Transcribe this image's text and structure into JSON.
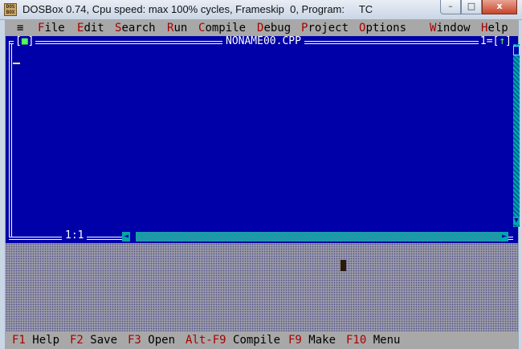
{
  "window": {
    "icon_text": "DOS BOX",
    "title": "DOSBox 0.74, Cpu speed: max 100% cycles, Frameskip  0, Program:     TC",
    "min_label": "–",
    "max_label": "□",
    "close_label": "x"
  },
  "menu": {
    "system_label": "≡",
    "items": [
      {
        "hot": "F",
        "rest": "ile"
      },
      {
        "hot": "E",
        "rest": "dit"
      },
      {
        "hot": "S",
        "rest": "earch"
      },
      {
        "hot": "R",
        "rest": "un"
      },
      {
        "hot": "C",
        "rest": "ompile"
      },
      {
        "hot": "D",
        "rest": "ebug"
      },
      {
        "hot": "P",
        "rest": "roject"
      },
      {
        "hot": "O",
        "rest": "ptions"
      },
      {
        "hot": "W",
        "rest": "indow"
      },
      {
        "hot": "H",
        "rest": "elp"
      }
    ]
  },
  "editor": {
    "close_box_left": "[",
    "close_box_mark": "■",
    "close_box_right": "]",
    "filename": "NONAME00.CPP",
    "window_number": "1",
    "zoom_left": "=[",
    "zoom_arrow": "↑",
    "zoom_right": "]",
    "cursor_position": "1:1",
    "scroll_up": "▲",
    "scroll_down": "▼",
    "scroll_left": "◄",
    "scroll_right": "►"
  },
  "hints": [
    {
      "key": "F1",
      "label": "Help"
    },
    {
      "key": "F2",
      "label": "Save"
    },
    {
      "key": "F3",
      "label": "Open"
    },
    {
      "key": "Alt-F9",
      "label": "Compile"
    },
    {
      "key": "F9",
      "label": "Make"
    },
    {
      "key": "F10",
      "label": "Menu"
    }
  ],
  "colors": {
    "editor_bg": "#0000a8",
    "menu_bg": "#a8a8a8",
    "hotkey": "#a80000",
    "cursor": "#ffff55",
    "scrollbar": "#00a8a8"
  }
}
